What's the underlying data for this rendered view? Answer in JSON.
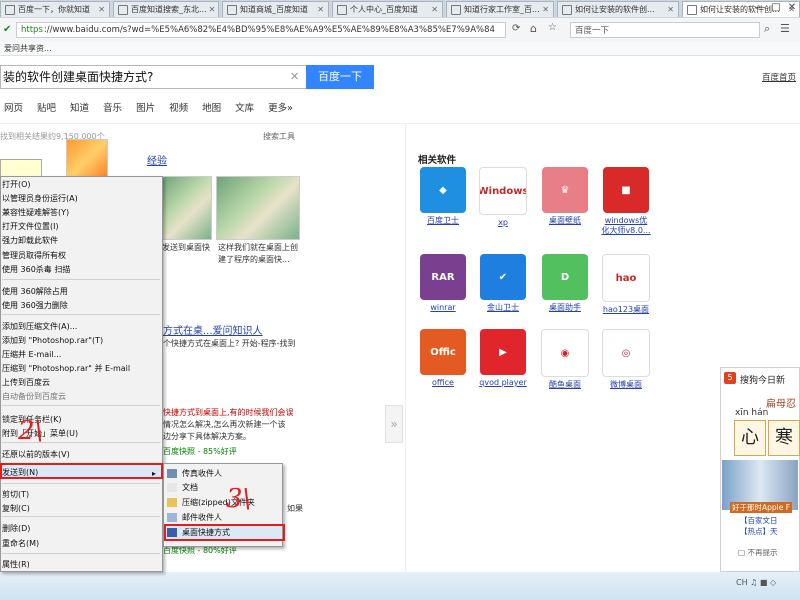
{
  "tabs": [
    {
      "title": "百度一下，你就知道",
      "active": false
    },
    {
      "title": "百度知道搜索_东北...",
      "active": false
    },
    {
      "title": "知道商城_百度知道",
      "active": false
    },
    {
      "title": "个人中心_百度知道",
      "active": false
    },
    {
      "title": "知道行家工作室_百...",
      "active": false
    },
    {
      "title": "如何让安装的软件创...",
      "active": false
    },
    {
      "title": "如何让安装的软件创...",
      "active": true
    }
  ],
  "window": {
    "minimize": "—",
    "maximize": "□",
    "close": "✕"
  },
  "address": {
    "https": "https",
    "rest": "://www.baidu.com/s?wd=%E5%A6%82%E4%BD%95%E8%AE%A9%E5%AE%89%E8%A3%85%E7%9A%84",
    "browser_search": "百度一下"
  },
  "favorites": {
    "item": "爱问共享资..."
  },
  "baidu": {
    "query": "装的软件创建桌面快捷方式?",
    "search_button": "百度一下",
    "settings": "百度首页",
    "nav": [
      "网页",
      "贴吧",
      "知道",
      "音乐",
      "图片",
      "视频",
      "地图",
      "文库",
      "更多»"
    ],
    "result_count": "找到相关结果约9,150,000个",
    "search_tools": "搜索工具",
    "experience_link": "经验"
  },
  "results": {
    "thumb1_cap1": "发送到桌面快",
    "thumb2_cap1": "这样我们就在桌面上创",
    "thumb2_cap2": "建了程序的桌面快...",
    "r2_title": "方式在桌...爱问知识人",
    "r2_snip": "个快捷方式在桌面上? 开始-程序-找到",
    "r3_snip1": "快捷方式到桌面上,有的时候我们会误",
    "r3_snip2": "情况怎么解决,怎么再次新建一个该",
    "r3_snip3": "边分享下具体解决方案。",
    "r3_green": "百度快照 - 85%好评",
    "r4_snip": "如果",
    "r4_green": "百度快照 - 80%好评"
  },
  "context_menu": {
    "items": [
      "打开(O)",
      "以管理员身份运行(A)",
      "兼容性疑难解答(Y)",
      "打开文件位置(I)",
      "强力卸载此软件",
      "管理员取得所有权",
      "使用 360杀毒 扫描",
      "使用 360解除占用",
      "使用 360强力删除",
      "添加到压缩文件(A)...",
      "添加到 \"Photoshop.rar\"(T)",
      "压缩并 E-mail...",
      "压缩到 \"Photoshop.rar\" 并 E-mail",
      "上传到百度云",
      "自动备份到百度云",
      "锁定到任务栏(K)",
      "附到「开始」菜单(U)",
      "还原以前的版本(V)",
      "发送到(N)",
      "剪切(T)",
      "复制(C)",
      "删除(D)",
      "重命名(M)",
      "属性(R)"
    ],
    "arrow": "▸"
  },
  "submenu": {
    "items": [
      "传真收件人",
      "文档",
      "压缩(zipped)文件夹",
      "邮件收件人",
      "桌面快捷方式"
    ]
  },
  "annotations": {
    "step2": "2\\",
    "step3": "3\\"
  },
  "related": {
    "title": "相关软件",
    "items": [
      {
        "name": "百度卫士",
        "color": "#1e8fe1",
        "glyph": "◆"
      },
      {
        "name": "xp",
        "color": "#ffffff",
        "glyph": "Windows"
      },
      {
        "name": "桌面壁纸",
        "color": "#e87f86",
        "glyph": "♛"
      },
      {
        "name": "windows优化大师v8.0...",
        "color": "#d92a2a",
        "glyph": "■"
      },
      {
        "name": "winrar",
        "color": "#7a3f8f",
        "glyph": "RAR"
      },
      {
        "name": "金山卫士",
        "color": "#1f7fe0",
        "glyph": "✔"
      },
      {
        "name": "桌面助手",
        "color": "#52c05e",
        "glyph": "D"
      },
      {
        "name": "hao123桌面",
        "color": "#ffffff",
        "glyph": "hao"
      },
      {
        "name": "office",
        "color": "#e35a22",
        "glyph": "Offic"
      },
      {
        "name": "qvod player",
        "color": "#e0262b",
        "glyph": "▶"
      },
      {
        "name": "酷鱼桌面",
        "color": "#ffffff",
        "glyph": "◉"
      },
      {
        "name": "微博桌面",
        "color": "#ffffff",
        "glyph": "◎"
      }
    ]
  },
  "sogou": {
    "badge": "5",
    "title": "搜狗今日新",
    "card_title": "扁母忍",
    "pinyin": "xīn    hán",
    "chars": [
      "心",
      "寒"
    ],
    "caption": "好于那时Apple F",
    "news1": "【百家文日",
    "news2": "【热点】天",
    "hide": "□ 不再提示"
  },
  "bottom": {
    "text": "CH ♫ ■ ◇"
  }
}
